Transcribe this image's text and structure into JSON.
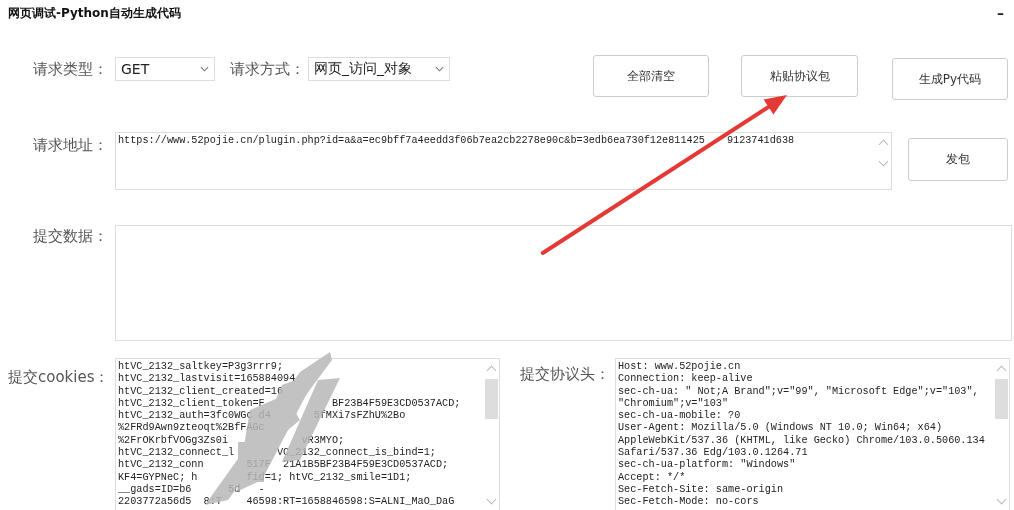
{
  "window": {
    "title": "网页调试-Python自动生成代码",
    "minimize": "–"
  },
  "request_type": {
    "label": "请求类型：",
    "value": "GET"
  },
  "request_mode": {
    "label": "请求方式：",
    "value": "网页_访问_对象"
  },
  "buttons": [
    {
      "label": "全部清空"
    },
    {
      "label": "粘贴协议包"
    },
    {
      "label": "生成Py代码"
    }
  ],
  "url": {
    "label": "请求地址：",
    "value_parts": [
      "https://www.52pojie.cn/plugin.php?id=a&a=ec9bff7a4eedd3f06b7ea2cb2278e90c&b=3edb6ea730f12e811425",
      "9123741d638"
    ]
  },
  "send_button": {
    "label": "发包"
  },
  "post_data": {
    "label": "提交数据："
  },
  "cookies": {
    "label": "提交cookies：",
    "lines": [
      "htVC_2132_saltkey=P3g3rrr9;",
      "htVC_2132_lastvisit=165884094",
      "htVC_2132_client_created=16",
      "htVC_2132_client_token=F           BF23B4F59E3CD0537ACD;",
      "htVC_2132_auth=3fc0WGc d4       5fMXi7sFZhU%2Bo",
      "%2FRd9Awn9zteoqt%2BfFAGc",
      "%2FrOKrbfVOGg3Zs0i            vR3MYO;",
      "htVC_2132_connect_l       VC_2132_connect_is_bind=1;",
      "htVC_2132_conn       517F  21A1B5BF23B4F59E3CD0537ACD;",
      "KF4=GYPNeC; h        fid=1; htVC_2132_smile=1D1;",
      "__gads=ID=b6      5d   -",
      "2203772a56d5  8:T    46598:RT=1658846598:S=ALNI_MaO_DaG"
    ]
  },
  "headers": {
    "label": "提交协议头：",
    "lines": [
      "Host: www.52pojie.cn",
      "Connection: keep-alive",
      "sec-ch-ua: \" Not;A Brand\";v=\"99\", \"Microsoft Edge\";v=\"103\",",
      "\"Chromium\";v=\"103\"",
      "sec-ch-ua-mobile: ?0",
      "User-Agent: Mozilla/5.0 (Windows NT 10.0; Win64; x64)",
      "AppleWebKit/537.36 (KHTML, like Gecko) Chrome/103.0.5060.134",
      "Safari/537.36 Edg/103.0.1264.71",
      "sec-ch-ua-platform: \"Windows\"",
      "Accept: */*",
      "Sec-Fetch-Site: same-origin",
      "Sec-Fetch-Mode: no-cors"
    ]
  }
}
